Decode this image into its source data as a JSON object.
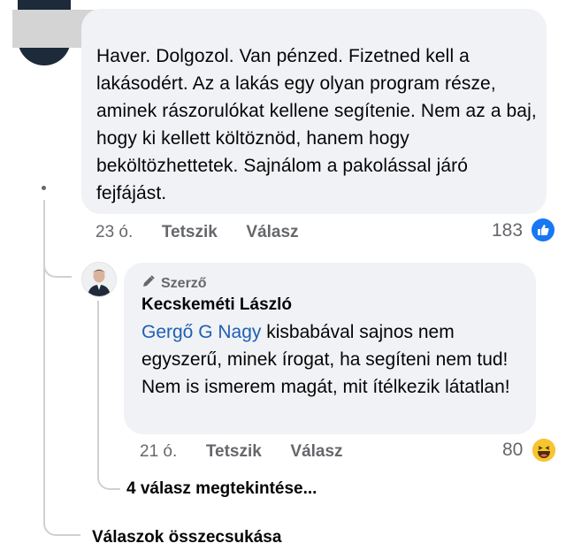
{
  "comment1": {
    "text": "Haver. Dolgozol. Van pénzed. Fizetned kell a lakásodért. Az a lakás egy olyan program része, aminek rászorulókat kellene segítenie. Nem az a baj, hogy ki kellett költöznöd, hanem hogy beköltözhettetek. Sajnálom a pakolással járó fejfájást.",
    "time": "23 ó.",
    "like_label": "Tetszik",
    "reply_label": "Válasz",
    "reaction_count": "183",
    "reaction_icon": "like-icon",
    "reaction_color": "#1877f2"
  },
  "reply1": {
    "badge": "Szerző",
    "author": "Kecskeméti László",
    "mention": "Gergő G Nagy",
    "text": " kisbabával sajnos nem egyszerű, minek írogat, ha segíteni nem tud! Nem is ismerem magát, mit ítélkezik látatlan!",
    "time": "21 ó.",
    "like_label": "Tetszik",
    "reply_label": "Válasz",
    "reaction_count": "80",
    "reaction_icon": "haha-icon"
  },
  "view_replies": "4 válasz megtekintése...",
  "collapse_replies": "Válaszok összecsukása",
  "colors": {
    "bubble": "#f0f2f5",
    "meta": "#65676b",
    "mention": "#1f5fb5"
  }
}
